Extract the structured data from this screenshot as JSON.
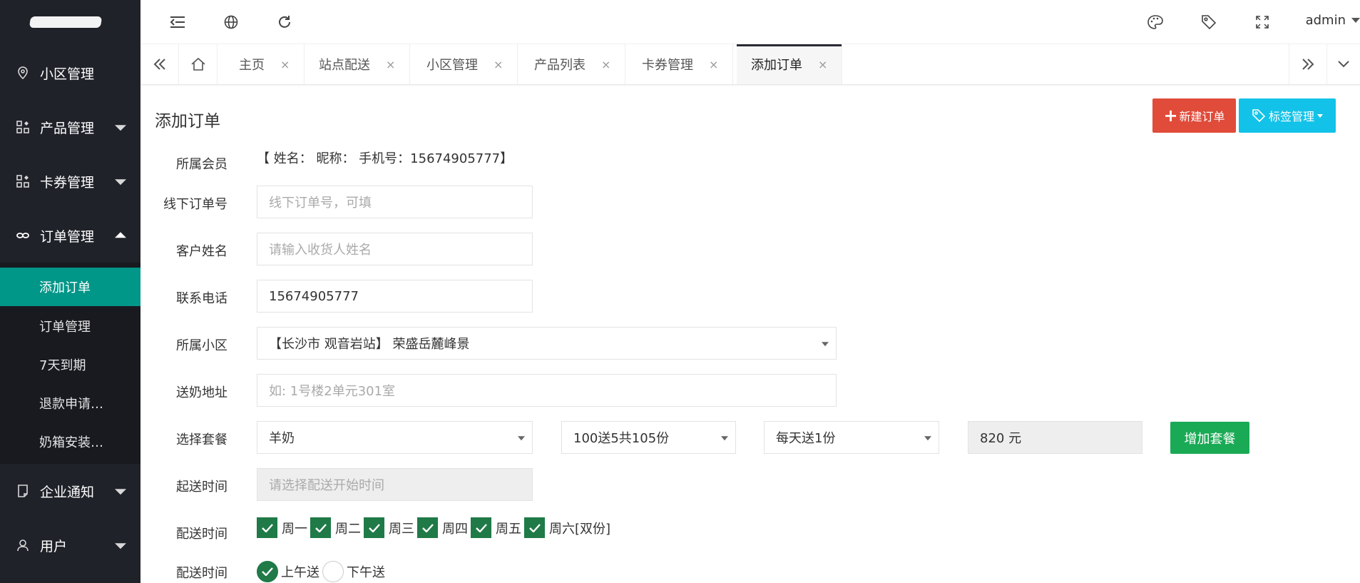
{
  "sidebar": {
    "items": [
      {
        "label": "小区管理",
        "icon": "location-icon"
      },
      {
        "label": "产品管理",
        "icon": "apps-icon"
      },
      {
        "label": "卡券管理",
        "icon": "apps-icon"
      },
      {
        "label": "订单管理",
        "icon": "link-icon"
      },
      {
        "label": "企业通知",
        "icon": "note-icon"
      },
      {
        "label": "用户",
        "icon": "user-icon"
      }
    ],
    "sub_items": [
      "添加订单",
      "订单管理",
      "7天到期",
      "退款申请…",
      "奶箱安装…"
    ]
  },
  "header": {
    "user": "admin",
    "icons": [
      "menu-fold-icon",
      "globe-icon",
      "refresh-icon",
      "theme-icon",
      "tag-icon",
      "fullscreen-icon"
    ]
  },
  "tabs": {
    "items": [
      "主页",
      "站点配送",
      "小区管理",
      "产品列表",
      "卡券管理",
      "添加订单"
    ],
    "close": "×"
  },
  "page": {
    "title": "添加订单",
    "new_order_button": "新建订单",
    "tag_manage_button": "标签管理",
    "add_package_button": "增加套餐"
  },
  "form": {
    "member_label": "所属会员",
    "member_value": "【 姓名： 昵称： 手机号：15674905777】",
    "offline_label": "线下订单号",
    "offline_placeholder": "线下订单号，可填",
    "customer_label": "客户姓名",
    "customer_placeholder": "请输入收货人姓名",
    "phone_label": "联系电话",
    "phone_value": "15674905777",
    "community_label": "所属小区",
    "community_value": "【长沙市 观音岩站】 荣盛岳麓峰景",
    "address_label": "送奶地址",
    "address_placeholder": "如: 1号楼2单元301室",
    "package_label": "选择套餐",
    "package_product": "羊奶",
    "package_plan": "100送5共105份",
    "package_frequency": "每天送1份",
    "package_price": "820 元",
    "start_label": "起送时间",
    "start_placeholder": "请选择配送开始时间",
    "days_label": "配送时间",
    "days": [
      "周一",
      "周二",
      "周三",
      "周四",
      "周五",
      "周六[双份]"
    ],
    "time_label": "配送时间",
    "time_options": [
      "上午送",
      "下午送"
    ]
  },
  "colors": {
    "sidebar_bg": "#20222a",
    "active_green": "#009688",
    "red": "#e04b3a",
    "cyan": "#13c2e8",
    "check_green": "#1f7a47",
    "add_green": "#1aaa55"
  }
}
